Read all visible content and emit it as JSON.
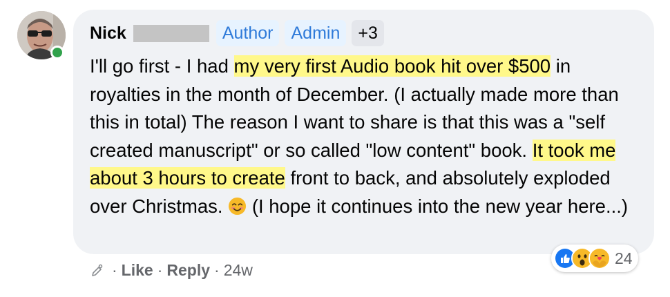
{
  "comment": {
    "author": "Nick",
    "badges": [
      "Author",
      "Admin",
      "+3"
    ],
    "text": {
      "p1": "I'll go first - I had ",
      "h1": "my very first Audio book hit over $500",
      "p2": " in royalties in the month of December. (I actually made more than this in total) The reason I want to share is that this was a \"self created manuscript\" or so called \"low content\" book. ",
      "h2": "It took me about 3 hours to create",
      "p3": " front to back, and absolutely exploded over Christmas. ",
      "emoji": "smiling-face-emoji",
      "p4": " (I hope it continues into the new year here...)"
    }
  },
  "actions": {
    "separator": "·",
    "like": "Like",
    "reply": "Reply",
    "age": "24w"
  },
  "reactions": {
    "icons": [
      "like-reaction-icon",
      "wow-reaction-icon",
      "care-reaction-icon"
    ],
    "count": "24"
  },
  "colors": {
    "bubble": "#f0f2f5",
    "highlight": "#fff88a",
    "badge_bg": "#e7f3ff",
    "badge_text": "#2e7ad9",
    "secondary_text": "#65676b",
    "online": "#31a24c"
  }
}
